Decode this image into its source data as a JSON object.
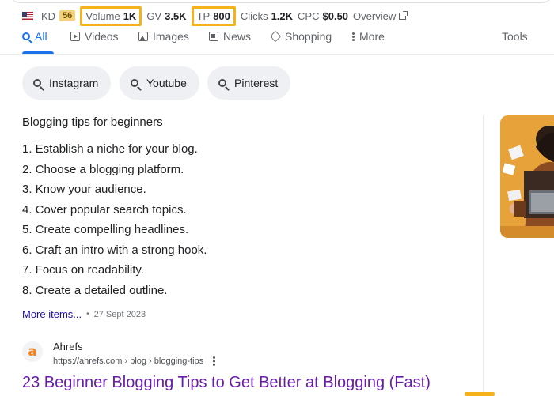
{
  "metrics": {
    "kd_label": "KD",
    "kd_value": "56",
    "volume_label": "Volume",
    "volume_value": "1K",
    "gv_label": "GV",
    "gv_value": "3.5K",
    "tp_label": "TP",
    "tp_value": "800",
    "clicks_label": "Clicks",
    "clicks_value": "1.2K",
    "cpc_label": "CPC",
    "cpc_value": "$0.50",
    "overview_label": "Overview",
    "highlight_color": "#f5b21b"
  },
  "tabs": [
    {
      "label": "All",
      "icon": "search-icon",
      "active": true
    },
    {
      "label": "Videos",
      "icon": "video-icon"
    },
    {
      "label": "Images",
      "icon": "image-icon"
    },
    {
      "label": "News",
      "icon": "news-icon"
    },
    {
      "label": "Shopping",
      "icon": "tag-icon"
    },
    {
      "label": "More",
      "icon": "more-dots-icon"
    }
  ],
  "tools_label": "Tools",
  "chips": [
    {
      "label": "Instagram"
    },
    {
      "label": "Youtube"
    },
    {
      "label": "Pinterest"
    }
  ],
  "snippet": {
    "title": "Blogging tips for beginners",
    "steps": [
      "1. Establish a niche for your blog.",
      "2. Choose a blogging platform.",
      "3. Know your audience.",
      "4. Cover popular search topics.",
      "5. Create compelling headlines.",
      "6. Craft an intro with a strong hook.",
      "7. Focus on readability.",
      "8. Create a detailed outline."
    ],
    "more_label": "More items...",
    "separator": "•",
    "date": "27 Sept 2023"
  },
  "source": {
    "favicon_letter": "a",
    "name": "Ahrefs",
    "url": "https://ahrefs.com › blog › blogging-tips",
    "title": "23 Beginner Blogging Tips to Get Better at Blogging (Fast)"
  },
  "colors": {
    "link_blue": "#1a73e8",
    "visited_purple": "#681da8",
    "kd_badge": "#f4d27a",
    "thumbnail_bg": "#e8a23a"
  }
}
